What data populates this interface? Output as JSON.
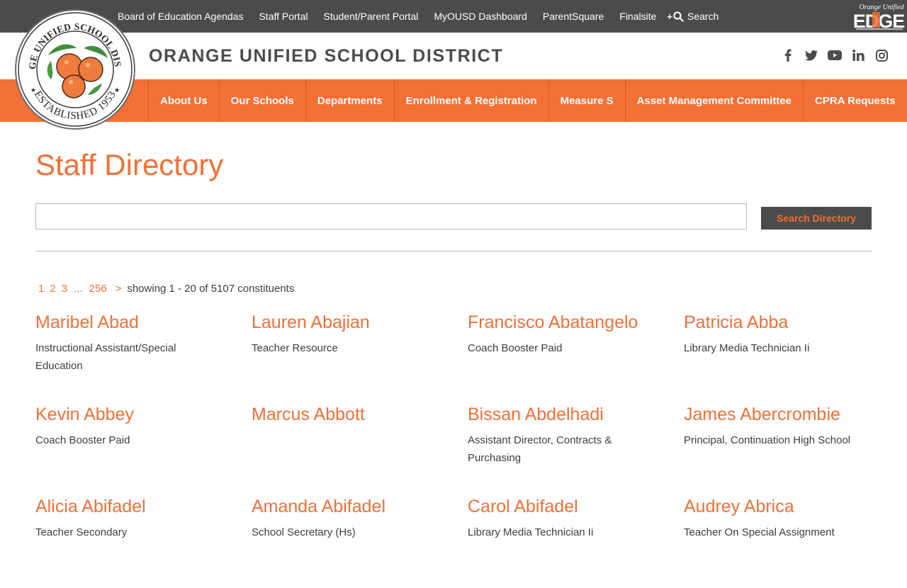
{
  "utility": {
    "links": [
      "Board of Education Agendas",
      "Staff Portal",
      "Student/Parent Portal",
      "MyOUSD Dashboard",
      "ParentSquare",
      "Finalsite"
    ],
    "search_label": "Search",
    "edge_logo_top": "Orange Unified",
    "edge_logo_text": "EDGE"
  },
  "header": {
    "title": "ORANGE UNIFIED SCHOOL DISTRICT",
    "seal_text_top": "ORANGE UNIFIED SCHOOL DISTRICT",
    "seal_text_bottom": "ESTABLISHED 1953",
    "social_icons": [
      "facebook-icon",
      "twitter-icon",
      "youtube-icon",
      "linkedin-icon",
      "instagram-icon"
    ]
  },
  "nav": {
    "items": [
      "About Us",
      "Our Schools",
      "Departments",
      "Enrollment & Registration",
      "Measure S",
      "Asset Management Committee",
      "CPRA Requests"
    ]
  },
  "main": {
    "title": "Staff Directory",
    "search": {
      "value": "",
      "placeholder": "",
      "button_label": "Search Directory"
    },
    "pager": {
      "pages": [
        "1",
        "2",
        "3"
      ],
      "gap": "...",
      "last": "256",
      "next": ">",
      "summary": "showing 1 - 20 of 5107 constituents"
    },
    "people": [
      {
        "name": "Maribel Abad",
        "title": "Instructional Assistant/Special Education"
      },
      {
        "name": "Lauren Abajian",
        "title": "Teacher Resource"
      },
      {
        "name": "Francisco Abatangelo",
        "title": "Coach Booster Paid"
      },
      {
        "name": "Patricia Abba",
        "title": "Library Media Technician Ii"
      },
      {
        "name": "Kevin Abbey",
        "title": "Coach Booster Paid"
      },
      {
        "name": "Marcus Abbott",
        "title": ""
      },
      {
        "name": "Bissan Abdelhadi",
        "title": "Assistant Director, Contracts & Purchasing"
      },
      {
        "name": "James Abercrombie",
        "title": "Principal, Continuation High School"
      },
      {
        "name": "Alicia Abifadel",
        "title": "Teacher Secondary"
      },
      {
        "name": "Amanda Abifadel",
        "title": "School Secretary (Hs)"
      },
      {
        "name": "Carol Abifadel",
        "title": "Library Media Technician Ii"
      },
      {
        "name": "Audrey Abrica",
        "title": "Teacher On Special Assignment"
      }
    ]
  },
  "colors": {
    "accent": "#f26f35",
    "dark": "#4b4b4b",
    "text": "#3d3d3d"
  }
}
